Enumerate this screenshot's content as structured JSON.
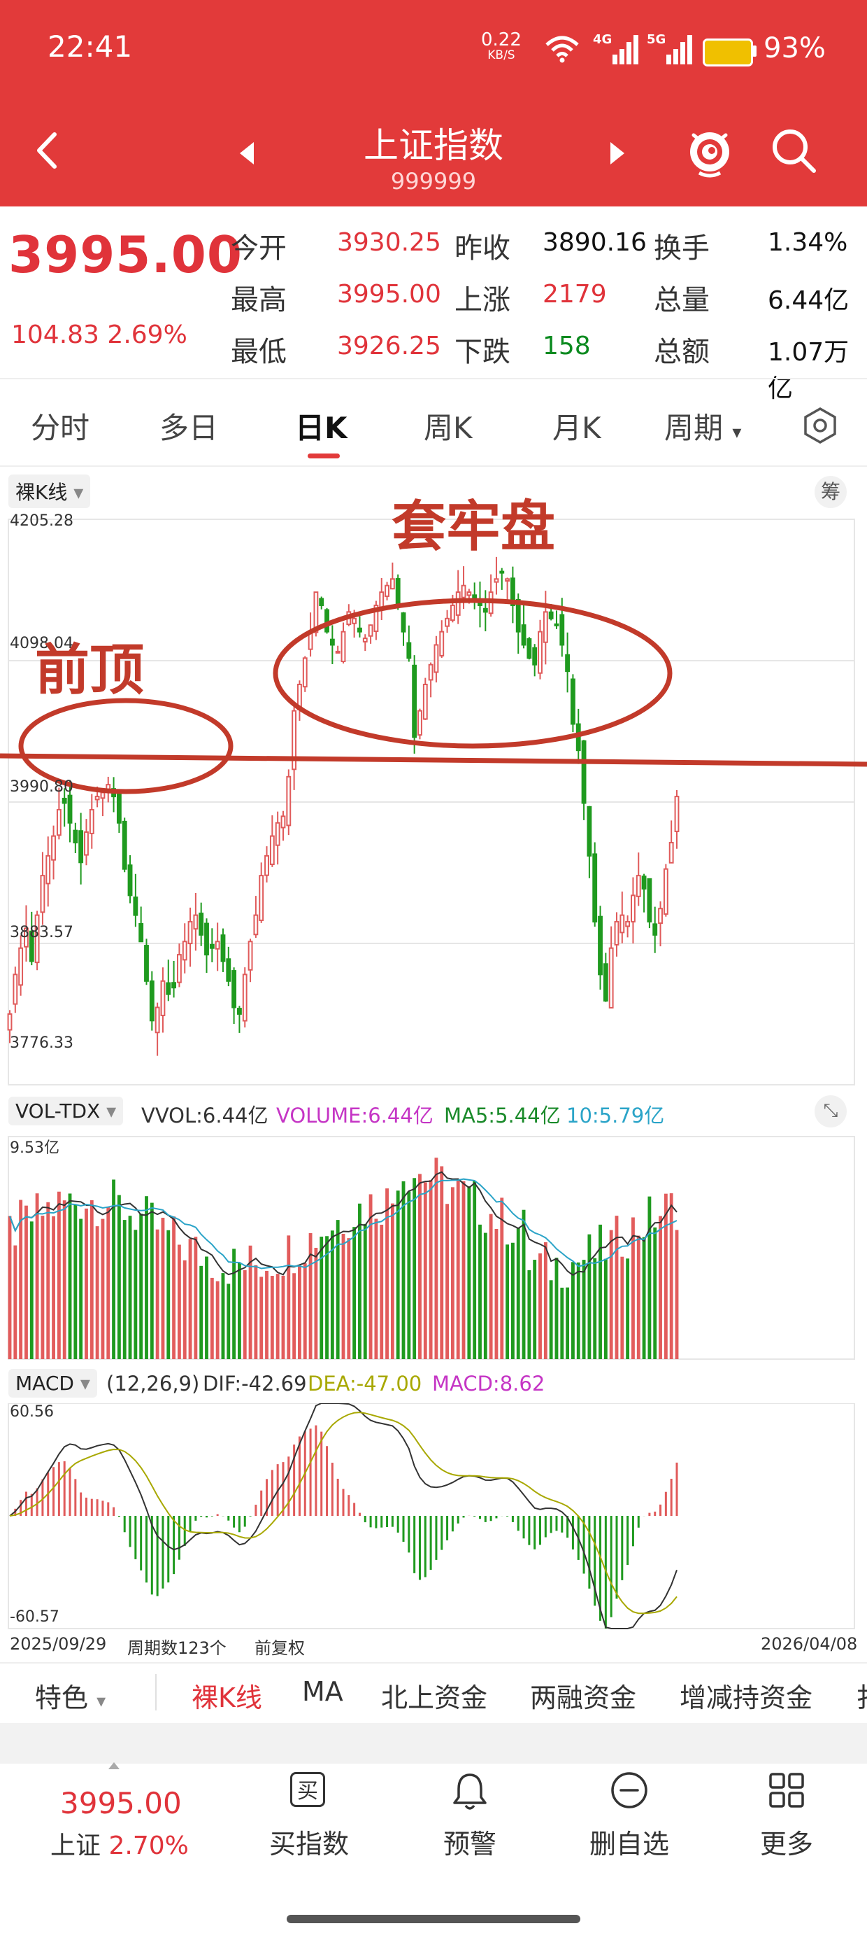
{
  "status_bar": {
    "time": "22:41",
    "net_speed": "0.22",
    "net_unit": "KB/S",
    "net1": "4G",
    "net2": "5G",
    "battery_pct": "93%",
    "battery_fill": 0.93
  },
  "header": {
    "title": "上证指数",
    "code": "999999"
  },
  "quote": {
    "price": "3995.00",
    "change": "104.83 2.69%",
    "fields": [
      {
        "label": "今开",
        "value": "3930.25",
        "color": "red"
      },
      {
        "label": "最高",
        "value": "3995.00",
        "color": "red"
      },
      {
        "label": "最低",
        "value": "3926.25",
        "color": "red"
      },
      {
        "label": "昨收",
        "value": "3890.16",
        "color": "black"
      },
      {
        "label": "上涨",
        "value": "2179",
        "color": "red"
      },
      {
        "label": "下跌",
        "value": "158",
        "color": "green"
      },
      {
        "label": "换手",
        "value": "1.34%",
        "color": "black"
      },
      {
        "label": "总量",
        "value": "6.44亿",
        "color": "black"
      },
      {
        "label": "总额",
        "value": "1.07万亿",
        "color": "black"
      }
    ]
  },
  "tabs": [
    "分时",
    "多日",
    "日K",
    "周K",
    "月K",
    "周期"
  ],
  "kline": {
    "mode_label": "裸K线",
    "chou_label": "筹",
    "y_top": "4205.28",
    "y_2": "4098.04",
    "y_3": "3990.80",
    "y_4": "3883.57",
    "y_bottom": "3776.33",
    "annotation_left": "前顶",
    "annotation_right": "套牢盘"
  },
  "volume": {
    "mode_label": "VOL-TDX",
    "vvol": "VVOL:6.44亿",
    "volume": "VOLUME:6.44亿",
    "ma5": "MA5:5.44亿",
    "ma10": "10:5.79亿",
    "y_top": "9.53亿"
  },
  "macd": {
    "mode_label": "MACD",
    "params": "(12,26,9)",
    "dif": "DIF:-42.69",
    "dea": "DEA:-47.00",
    "macd": "MACD:8.62",
    "y_top": "60.56",
    "y_bottom": "-60.57",
    "start_date": "2025/09/29",
    "period_count": "周期数123个",
    "adjust": "前复权",
    "end_date": "2026/04/08"
  },
  "chip_bar": [
    "特色",
    "裸K线",
    "MA",
    "北上资金",
    "两融资金",
    "增减持资金",
    "扌"
  ],
  "bottom_nav": {
    "price": "3995.00",
    "index_name": "上证",
    "index_change": "2.70%",
    "items": [
      "买指数",
      "预警",
      "删自选",
      "更多"
    ],
    "buy_icon_char": "买"
  },
  "chart_data": [
    {
      "type": "candlestick",
      "title": "",
      "ylim": [
        3776.33,
        4205.28
      ],
      "x_range": [
        "2025/09/29",
        "2026/04/08"
      ],
      "period_count": 123,
      "closes": [
        3830,
        3860,
        3880,
        3895,
        3870,
        3905,
        3935,
        3950,
        3965,
        3985,
        3990,
        3975,
        3960,
        3945,
        3968,
        3985,
        3995,
        3998,
        4004,
        3995,
        3975,
        3940,
        3920,
        3905,
        3885,
        3855,
        3825,
        3835,
        3855,
        3845,
        3850,
        3875,
        3885,
        3900,
        3905,
        3890,
        3875,
        3880,
        3885,
        3870,
        3855,
        3835,
        3830,
        3860,
        3885,
        3905,
        3935,
        3950,
        3965,
        3975,
        3980,
        4010,
        4060,
        4080,
        4100,
        4120,
        4150,
        4140,
        4120,
        4110,
        4105,
        4120,
        4135,
        4130,
        4120,
        4115,
        4125,
        4140,
        4150,
        4155,
        4160,
        4140,
        4120,
        4100,
        4040,
        4060,
        4080,
        4095,
        4110,
        4120,
        4130,
        4140,
        4150,
        4155,
        4150,
        4145,
        4140,
        4135,
        4150,
        4160,
        4165,
        4160,
        4140,
        4120,
        4110,
        4100,
        4095,
        4120,
        4135,
        4130,
        4125,
        4110,
        4090,
        4050,
        4030,
        3990,
        3950,
        3900,
        3860,
        3840,
        3880,
        3900,
        3905,
        3900,
        3920,
        3935,
        3925,
        3900,
        3890,
        3910,
        3940,
        3960,
        3995
      ]
    },
    {
      "type": "bar",
      "title": "",
      "ylim": [
        0,
        9.53
      ],
      "y_unit": "亿",
      "series_names": [
        "VOLUME",
        "MA5",
        "MA10"
      ]
    },
    {
      "type": "line",
      "title": "",
      "ylim": [
        -60.57,
        60.56
      ],
      "series": [
        {
          "name": "DIF",
          "last": -42.69
        },
        {
          "name": "DEA",
          "last": -47.0
        },
        {
          "name": "MACD",
          "last": 8.62
        }
      ]
    }
  ]
}
